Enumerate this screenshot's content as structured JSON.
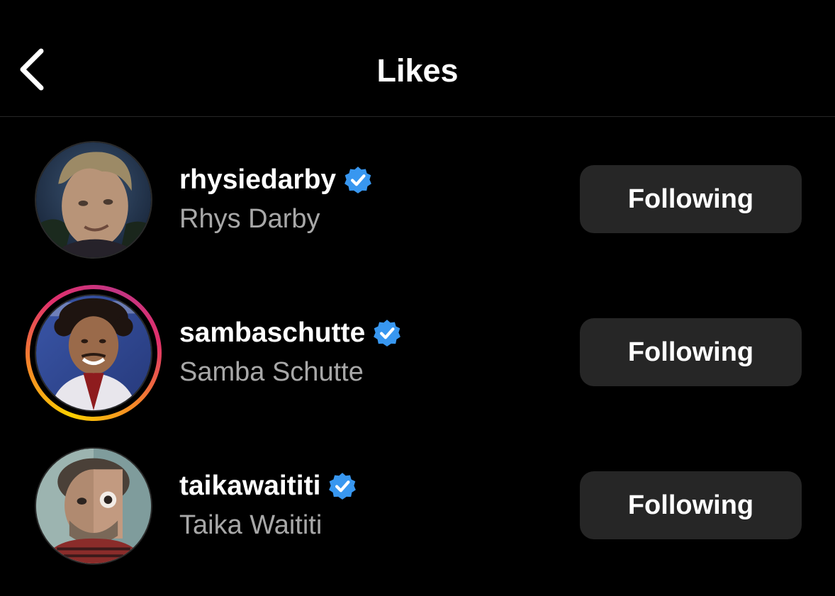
{
  "header": {
    "title": "Likes",
    "back_icon": "chevron-left-icon"
  },
  "colors": {
    "background": "#000000",
    "button_bg": "#262626",
    "secondary_text": "#a8a8a8",
    "verified_blue": "#3897f0"
  },
  "users": [
    {
      "username": "rhysiedarby",
      "full_name": "Rhys Darby",
      "verified": true,
      "has_story": false,
      "button_label": "Following"
    },
    {
      "username": "sambaschutte",
      "full_name": "Samba Schutte",
      "verified": true,
      "has_story": true,
      "button_label": "Following"
    },
    {
      "username": "taikawaititi",
      "full_name": "Taika Waititi",
      "verified": true,
      "has_story": false,
      "button_label": "Following"
    }
  ]
}
